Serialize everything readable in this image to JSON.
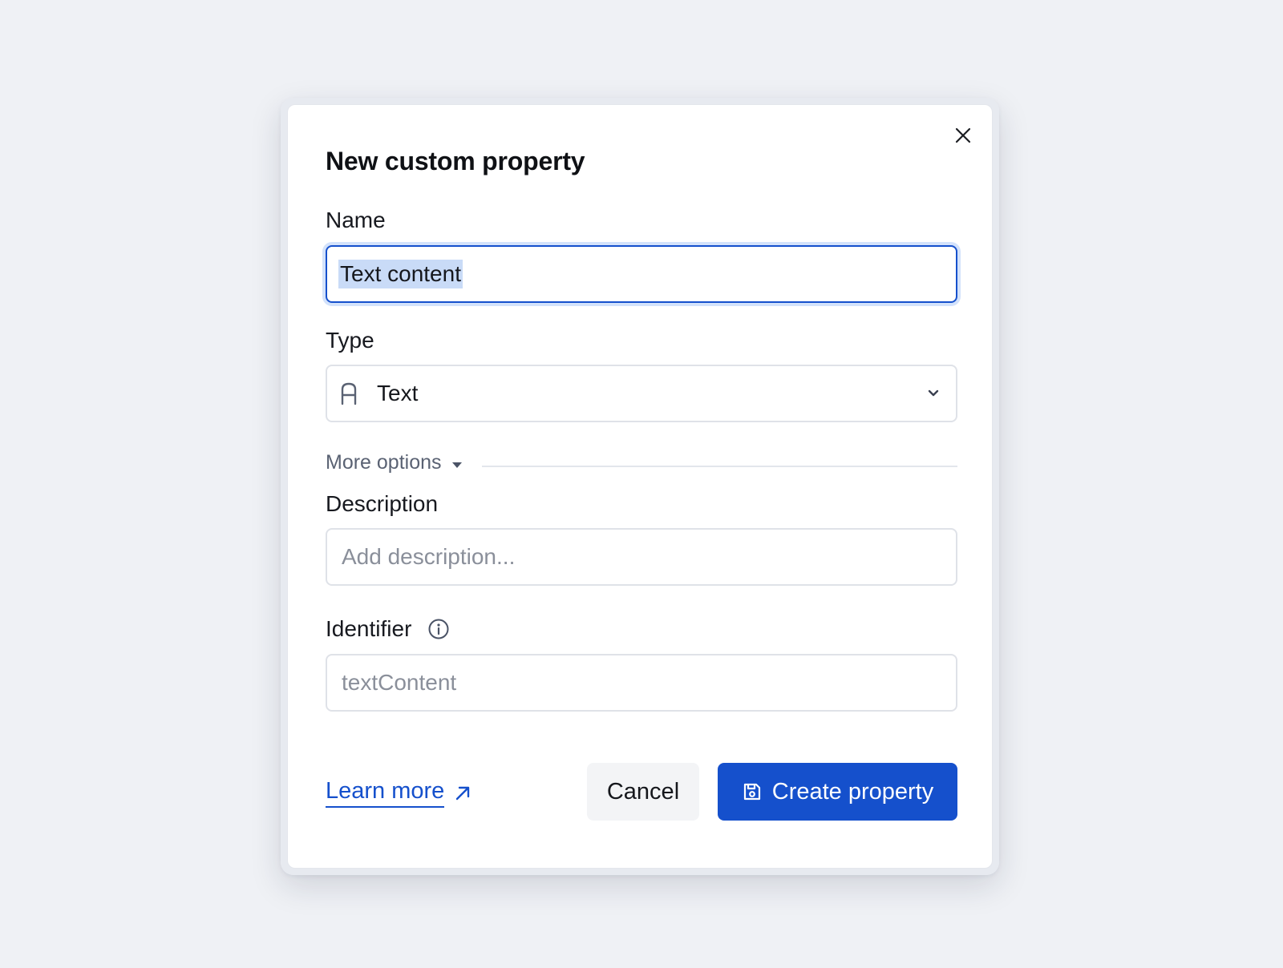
{
  "dialog": {
    "title": "New custom property",
    "close_icon": "close-icon"
  },
  "name_field": {
    "label": "Name",
    "value": "Text content",
    "selected": true
  },
  "type_field": {
    "label": "Type",
    "icon": "text-type-icon",
    "value": "Text",
    "chevron_icon": "chevron-down-icon"
  },
  "more_options": {
    "label": "More options",
    "icon": "caret-down-icon"
  },
  "description_field": {
    "label": "Description",
    "value": "",
    "placeholder": "Add description..."
  },
  "identifier_field": {
    "label": "Identifier",
    "info_icon": "info-icon",
    "value": "",
    "placeholder": "textContent"
  },
  "footer": {
    "learn_more_label": "Learn more",
    "learn_more_icon": "external-link-arrow-icon",
    "cancel_label": "Cancel",
    "create_label": "Create property",
    "create_icon": "save-icon"
  },
  "colors": {
    "background": "#eff1f5",
    "primary": "#1550cc",
    "focus_ring": "#d3e2fb",
    "selection": "#c9dbf7",
    "muted_text": "#5a6273",
    "placeholder": "#8a8f9a"
  }
}
